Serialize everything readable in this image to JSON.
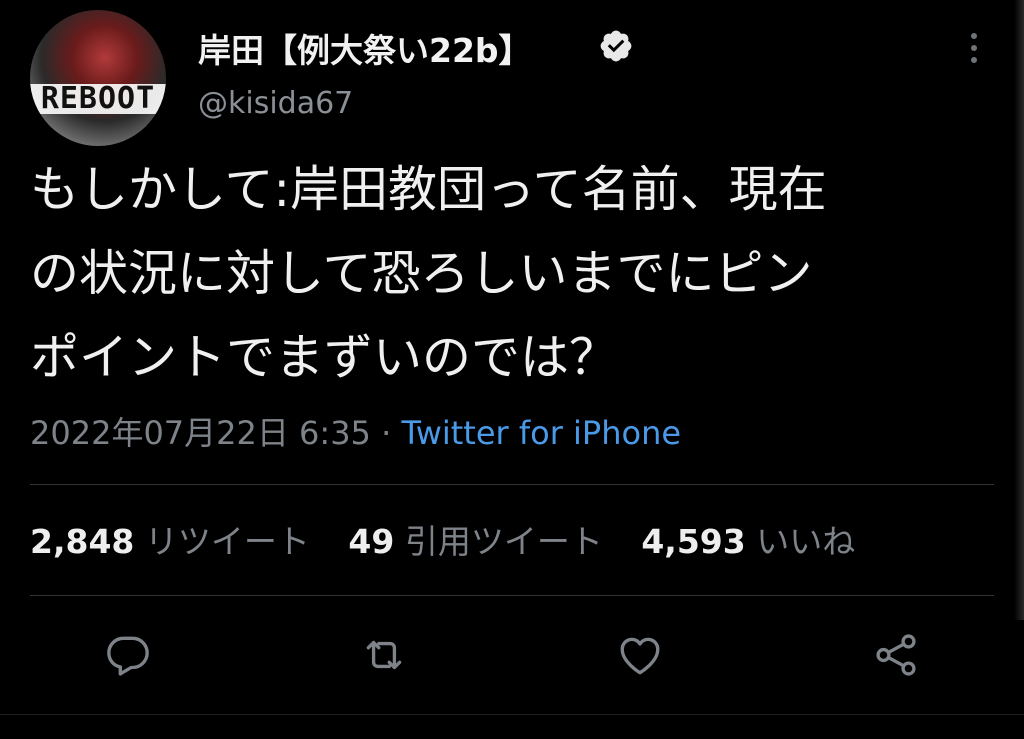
{
  "tweet": {
    "display_name": "岸田【例大祭い22b】",
    "handle": "@kisida67",
    "avatar_text": "REBOOT",
    "text_lines": [
      "もしかして:岸田教団って名前、現在",
      "の状況に対して恐ろしいまでにピン",
      "ポイントでまずいのでは？"
    ],
    "timestamp": "2022年07月22日 6:35",
    "separator": " · ",
    "source": "Twitter for iPhone"
  },
  "stats": {
    "retweets": {
      "count": "2,848",
      "label": "リツイート"
    },
    "quotes": {
      "count": "49",
      "label": "引用ツイート"
    },
    "likes": {
      "count": "4,593",
      "label": "いいね"
    }
  },
  "actions": [
    "reply-icon",
    "retweet-icon",
    "like-icon",
    "share-icon"
  ],
  "colors": {
    "background": "#000000",
    "text": "#f0f0f0",
    "secondary": "#7e8389",
    "link": "#4a9ae8"
  }
}
